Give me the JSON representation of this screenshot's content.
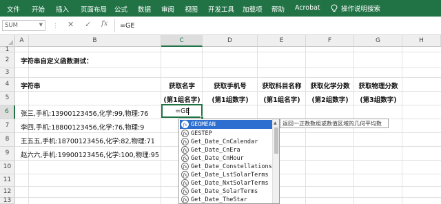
{
  "ribbon": {
    "tabs": [
      "文件",
      "开始",
      "插入",
      "页面布局",
      "公式",
      "数据",
      "审阅",
      "视图",
      "开发工具",
      "加载项",
      "帮助",
      "Acrobat"
    ],
    "tell_me": "操作说明搜索",
    "bg_color": "#217346"
  },
  "formula_bar": {
    "name_box": "SUM",
    "cancel_icon": "✕",
    "enter_icon": "✓",
    "fx_label": "fx",
    "content": "=GE"
  },
  "columns": [
    "A",
    "B",
    "C",
    "D",
    "E",
    "F",
    "G",
    "H"
  ],
  "rows": [
    "1",
    "2",
    "3",
    "4",
    "5",
    "6",
    "7",
    "8",
    "9",
    "10",
    "11",
    "12",
    "13"
  ],
  "sheet": {
    "title": "字符串自定义函数测试：",
    "header_row4": {
      "b": "字符串",
      "c": "获取名字",
      "d": "获取手机号",
      "e": "获取科目名称",
      "f": "获取化学分数",
      "g": "获取物理分数"
    },
    "header_row5": {
      "c": "(第1组名字)",
      "d": "(第1组数字)",
      "e": "(第1组名字)",
      "f": "(第2组数字)",
      "g": "(第3组数字)"
    },
    "data": [
      "张三,手机:13900123456,化学:99,物理:76",
      "李四,手机:18800123456,化学:76,物理:9",
      "王五五,手机:18700123456,化学:82,物理:71",
      "赵六六,手机:19900123456,化学:100,物理:95"
    ],
    "active_cell_text": "=GE"
  },
  "autocomplete": {
    "items": [
      "GEOMEAN",
      "GESTEP",
      "Get_Date_CnCalendar",
      "Get_Date_CnEra",
      "Get_Date_CnHour",
      "Get_Date_Constellations",
      "Get_Date_LstSolarTerms",
      "Get_Date_NxtSolarTerms",
      "Get_Date_SolarTerms",
      "Get_Date_TheStar"
    ],
    "tooltip": "返回一正数数组或数值区域的几何平均数"
  }
}
